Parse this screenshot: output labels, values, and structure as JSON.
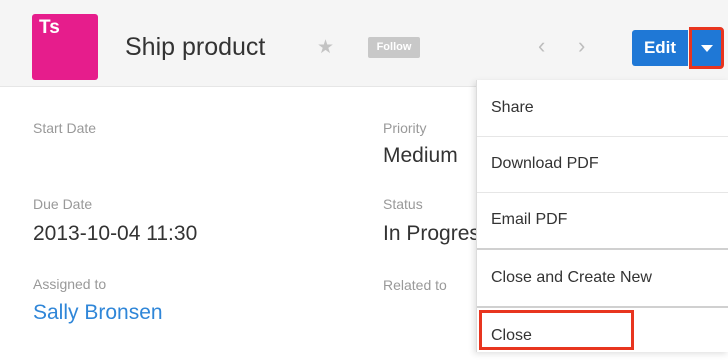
{
  "header": {
    "avatar_initials": "Ts",
    "title": "Ship product",
    "star_icon": "star-icon",
    "follow_label": "Follow",
    "prev_icon": "chevron-left-icon",
    "next_icon": "chevron-right-icon",
    "edit_label": "Edit",
    "actions_icon": "caret-down-icon"
  },
  "fields": {
    "start_date": {
      "label": "Start Date",
      "value": ""
    },
    "priority": {
      "label": "Priority",
      "value": "Medium"
    },
    "due_date": {
      "label": "Due Date",
      "value": "2013-10-04 11:30"
    },
    "status": {
      "label": "Status",
      "value": "In Progress"
    },
    "assigned_to": {
      "label": "Assigned to",
      "value": "Sally Bronsen"
    },
    "related_to": {
      "label": "Related to",
      "value": ""
    }
  },
  "actions_menu": {
    "items": [
      {
        "label": "Share"
      },
      {
        "label": "Download PDF"
      },
      {
        "label": "Email PDF"
      },
      {
        "label": "Close and Create New"
      },
      {
        "label": "Close"
      }
    ]
  },
  "colors": {
    "avatar": "#e61d8c",
    "primary_button": "#1f78d6",
    "link": "#2f86d8",
    "highlight": "#e8351f"
  }
}
